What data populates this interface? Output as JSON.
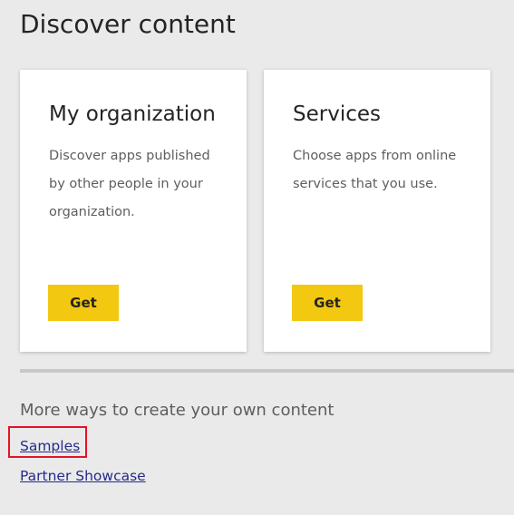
{
  "header": {
    "title": "Discover content"
  },
  "cards": [
    {
      "title": "My organization",
      "description": "Discover apps published by other people in your organization.",
      "button_label": "Get"
    },
    {
      "title": "Services",
      "description": "Choose apps from online services that you use.",
      "button_label": "Get"
    }
  ],
  "more_ways": {
    "heading": "More ways to create your own content",
    "links": [
      {
        "label": "Samples"
      },
      {
        "label": "Partner Showcase"
      }
    ]
  },
  "colors": {
    "background": "#eaeaea",
    "card": "#ffffff",
    "button": "#f2c811",
    "link": "#252a8a",
    "highlight": "#e81123"
  }
}
